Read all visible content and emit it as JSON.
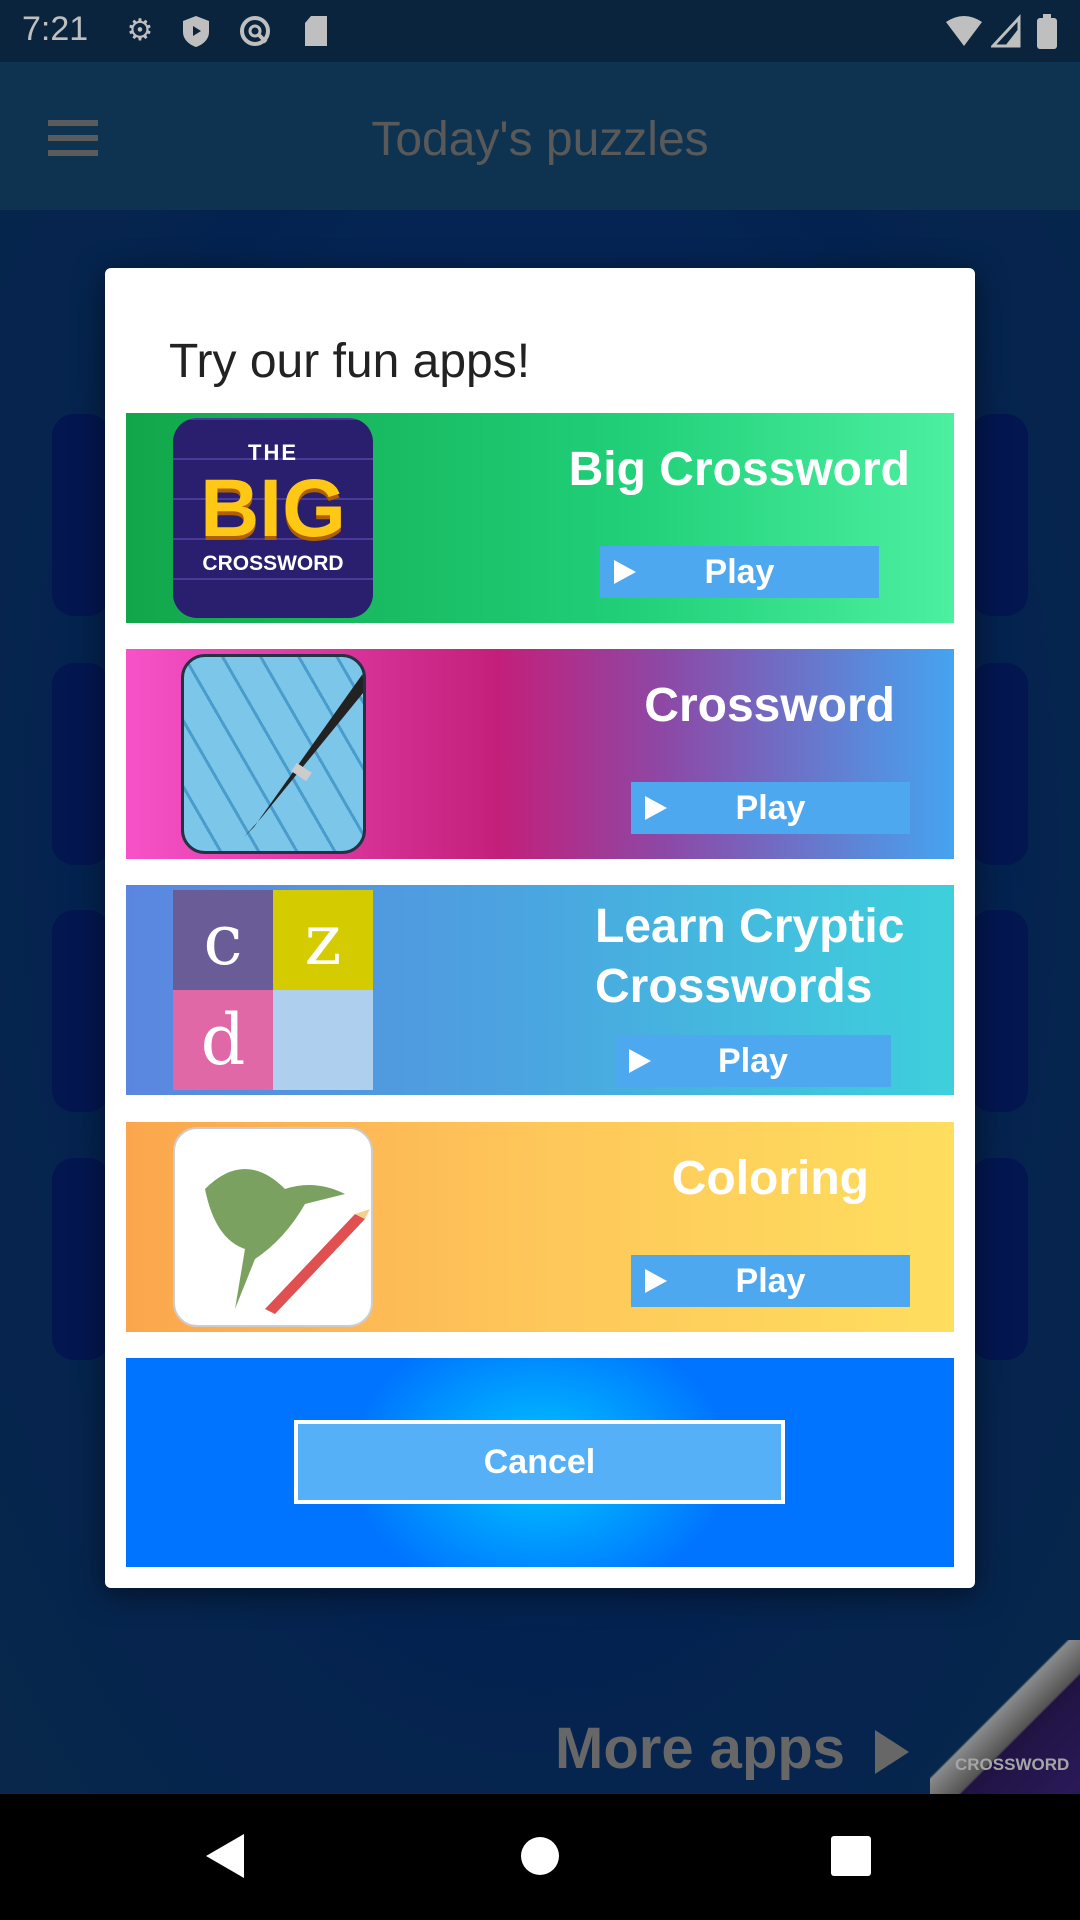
{
  "status_bar": {
    "time": "7:21",
    "left_icons": [
      "gear-icon",
      "shield-play-icon",
      "vpn-icon",
      "sd-card-icon"
    ],
    "right_icons": [
      "wifi-icon",
      "signal-icon",
      "battery-icon"
    ]
  },
  "app_bar": {
    "title": "Today's puzzles",
    "menu_icon": "hamburger-icon"
  },
  "dialog": {
    "title": "Try our fun apps!",
    "apps": [
      {
        "name": "Big Crossword",
        "play_label": "Play",
        "logo_text": [
          "THE",
          "BIG",
          "CROSSWORD"
        ],
        "colors": [
          "#12a64a",
          "#4cf0a0"
        ]
      },
      {
        "name": "Crossword",
        "play_label": "Play",
        "colors": [
          "#f752c8",
          "#45a4f0"
        ]
      },
      {
        "name_lines": [
          "Learn Cryptic",
          "Crosswords"
        ],
        "play_label": "Play",
        "logo_letters": [
          "c",
          "z",
          "d"
        ],
        "colors": [
          "#5b86e0",
          "#3dd0dc"
        ]
      },
      {
        "name": "Coloring",
        "play_label": "Play",
        "colors": [
          "#fba64e",
          "#fede5e"
        ]
      }
    ],
    "cancel_label": "Cancel"
  },
  "more_apps": {
    "label": "More apps",
    "peel_text": "CROSSWORD"
  },
  "nav_bar": {
    "icons": [
      "back-icon",
      "home-icon",
      "recents-icon"
    ]
  }
}
